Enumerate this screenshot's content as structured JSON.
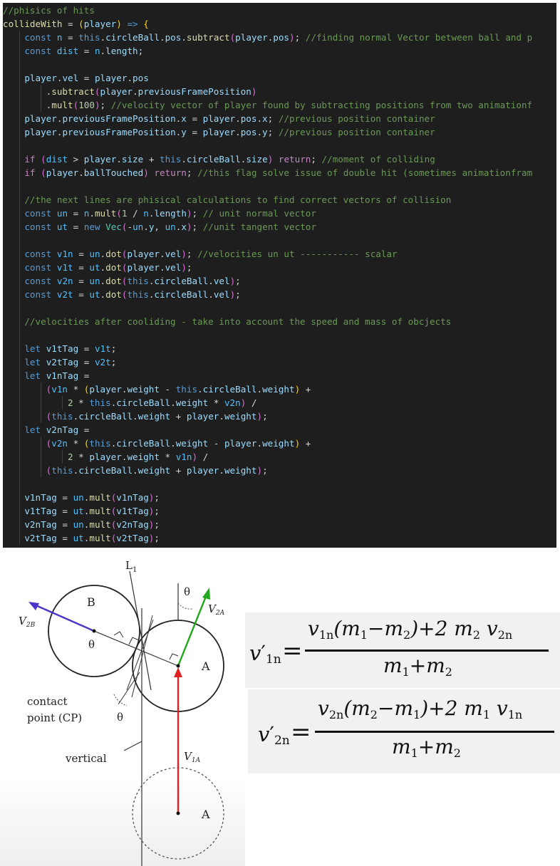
{
  "code": {
    "line_01_comment": "//phisics of hits",
    "line_02_name": "collideWith",
    "line_02_param": "player",
    "line_03_comment": "//finding normal Vector between ball and p",
    "line_07_comment": "//velocity vector of player found by subtracting positions from two animationf",
    "line_08_comment": "//previous position container",
    "line_09_comment": "//previous position container",
    "line_11_comment": "//moment of colliding",
    "line_12_comment": "//this flag solve issue of double hit (sometimes animationfram",
    "line_14_comment": "//the next lines are phisical calculations to find correct vectors of collision",
    "line_15_comment": "// unit normal vector",
    "line_16_comment": "//unit tangent vector",
    "line_18_comment": "//velocities un ut ----------- scalar",
    "line_23_comment": "//velocities after cooliding - take into account the speed and mass of obcjects",
    "mult_arg": "100"
  },
  "diagram": {
    "label_L1": "L",
    "label_L1_sub": "1",
    "label_theta": "θ",
    "label_B": "B",
    "label_A": "A",
    "label_V2B": "V",
    "label_V2B_sub": "2B",
    "label_V2A": "V",
    "label_V2A_sub": "2A",
    "label_V1A": "V",
    "label_V1A_sub": "1A",
    "label_contact": "contact",
    "label_point": "point (CP)",
    "label_vertical": "vertical",
    "colors": {
      "v2b_arrow": "#4a35c8",
      "v2a_arrow": "#22a81e",
      "v1a_arrow": "#e02222"
    }
  },
  "formulas": {
    "f1": {
      "lhs": "v",
      "lhs_prime": "′",
      "lhs_sub": "1n",
      "eq": "=",
      "numerator_a": "v",
      "numerator_a_sub": "1n",
      "numerator_b": "(m",
      "m1_sub": "1",
      "minus": "−m",
      "m2_sub": "2",
      "numerator_c": ")+2 m",
      "numerator_c_sub": "2",
      "numerator_d": " v",
      "numerator_d_sub": "2n",
      "den_a": "m",
      "den_a_sub": "1",
      "den_b": "+m",
      "den_b_sub": "2"
    },
    "f2": {
      "lhs": "v",
      "lhs_prime": "′",
      "lhs_sub": "2n",
      "eq": "=",
      "numerator_a": "v",
      "numerator_a_sub": "2n",
      "numerator_b": "(m",
      "m1_sub": "2",
      "minus": "−m",
      "m2_sub": "1",
      "numerator_c": ")+2 m",
      "numerator_c_sub": "1",
      "numerator_d": " v",
      "numerator_d_sub": "1n",
      "den_a": "m",
      "den_a_sub": "1",
      "den_b": "+m",
      "den_b_sub": "2"
    }
  }
}
